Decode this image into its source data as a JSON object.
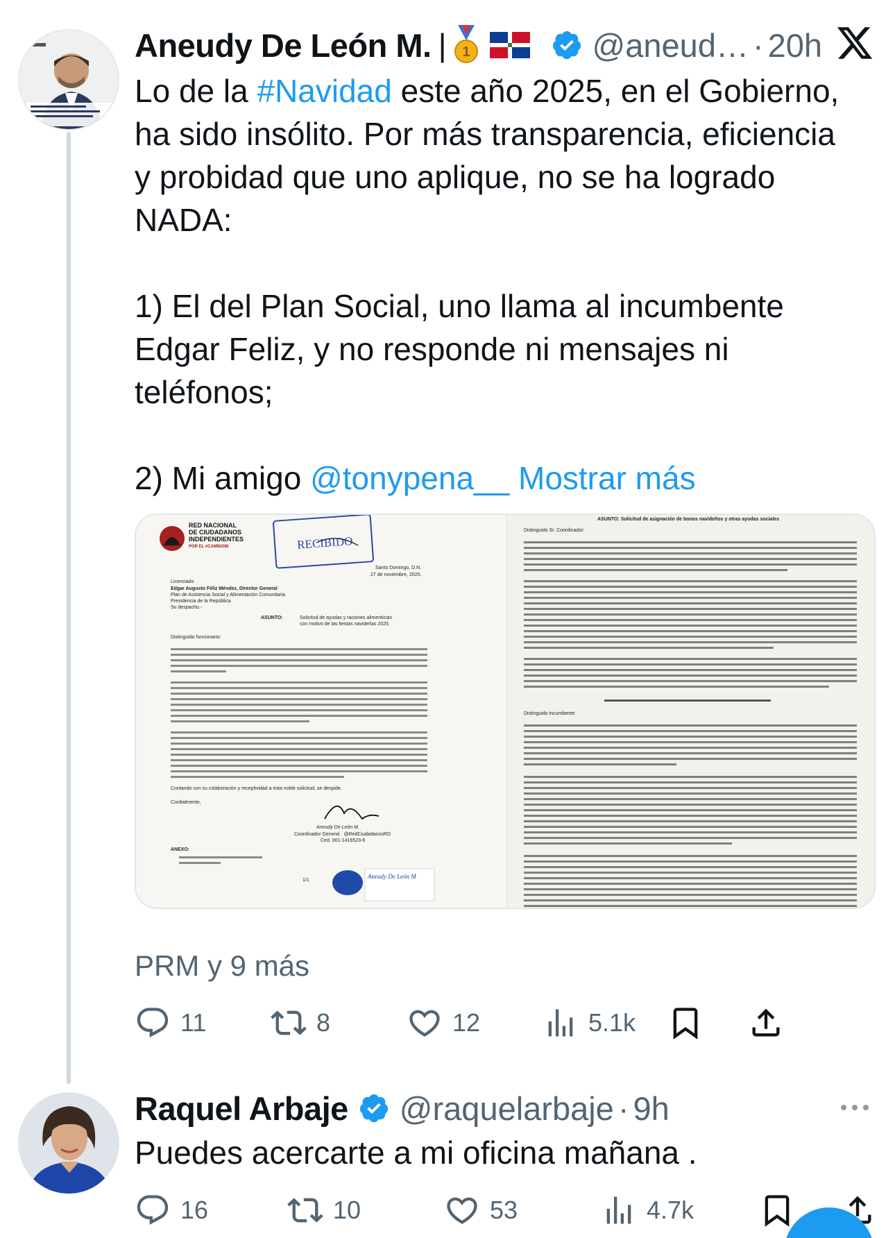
{
  "tweet1": {
    "author": "Aneudy De León M.",
    "separator": "|",
    "handle": "@aneud…",
    "dot": "·",
    "time": "20h",
    "text_before_hashtag": "Lo de la ",
    "hashtag": "#Navidad",
    "text_after_hashtag": " este año 2025, en el Gobierno,\nha sido insólito. Por más transparencia, eficiencia\ny probidad que uno aplique, no se ha logrado\nNADA:\n\n1) El del Plan Social, uno llama al incumbente\nEdgar Feliz, y no responde ni mensajes ni\nteléfonos;\n\n2) Mi amigo ",
    "mention": "@tonypena__",
    "show_more": "Mostrar más",
    "tagged": "PRM y 9 más",
    "metrics": {
      "replies": "11",
      "reposts": "8",
      "likes": "12",
      "views": "5.1k"
    }
  },
  "tweet2": {
    "author": "Raquel Arbaje",
    "handle": "@raquelarbaje",
    "dot": "·",
    "time": "9h",
    "text": "Puedes acercarte a mi oficina mañana .",
    "metrics": {
      "replies": "16",
      "reposts": "10",
      "likes": "53",
      "views": "4.7k"
    }
  },
  "documents": {
    "left": {
      "org_lines": [
        "RED NACIONAL",
        "DE CIUDADANOS",
        "INDEPENDIENTES",
        "POR EL #CAMBIOBI"
      ],
      "stamp": "RECIBIDO",
      "date": "Santo Domingo, D.N.",
      "date2": "27 de noviembre, 2025.",
      "addressee": [
        "Licenciado",
        "Edgar Augusto Féliz Méndez, Director General",
        "Plan de Asistencia Social y Alimentación Comunitaria",
        "Presidencia de la República",
        "Su despacho.-"
      ],
      "subject_label": "ASUNTO:",
      "subject": "Solicitud de ayudas y raciones alimenticias",
      "subject2": "con motivo de las fiestas navideñas 2025.",
      "greeting": "Distinguido funcionario:",
      "closing": "Contando con su colaboración y receptividad a esta noble solicitud, se despide,",
      "cordially": "Cordialmente,",
      "signer": "Aneudy De León M.",
      "signer_title": "Coordinador General · @RedCiudadanosRD",
      "signer_id": "Ced. 001-1416523-6",
      "annex": "ANEXO:",
      "page": "1/1",
      "footer_name": "Aneudy De León M"
    },
    "right": {
      "subject": "ASUNTO: Solicitud de asignación de bonos navideños y otras ayudas sociales",
      "greeting": "Distinguido Sr. Coordinador:",
      "greeting2": "Distinguido incumbente:"
    }
  },
  "colors": {
    "accent": "#1d9bf0",
    "muted": "#536471",
    "text": "#0f1419"
  },
  "icons": [
    "medal-icon",
    "dominican-flag-icon",
    "verified-badge-icon",
    "x-logo-icon",
    "more-icon",
    "reply-icon",
    "repost-icon",
    "like-icon",
    "views-icon",
    "bookmark-icon",
    "share-icon"
  ]
}
